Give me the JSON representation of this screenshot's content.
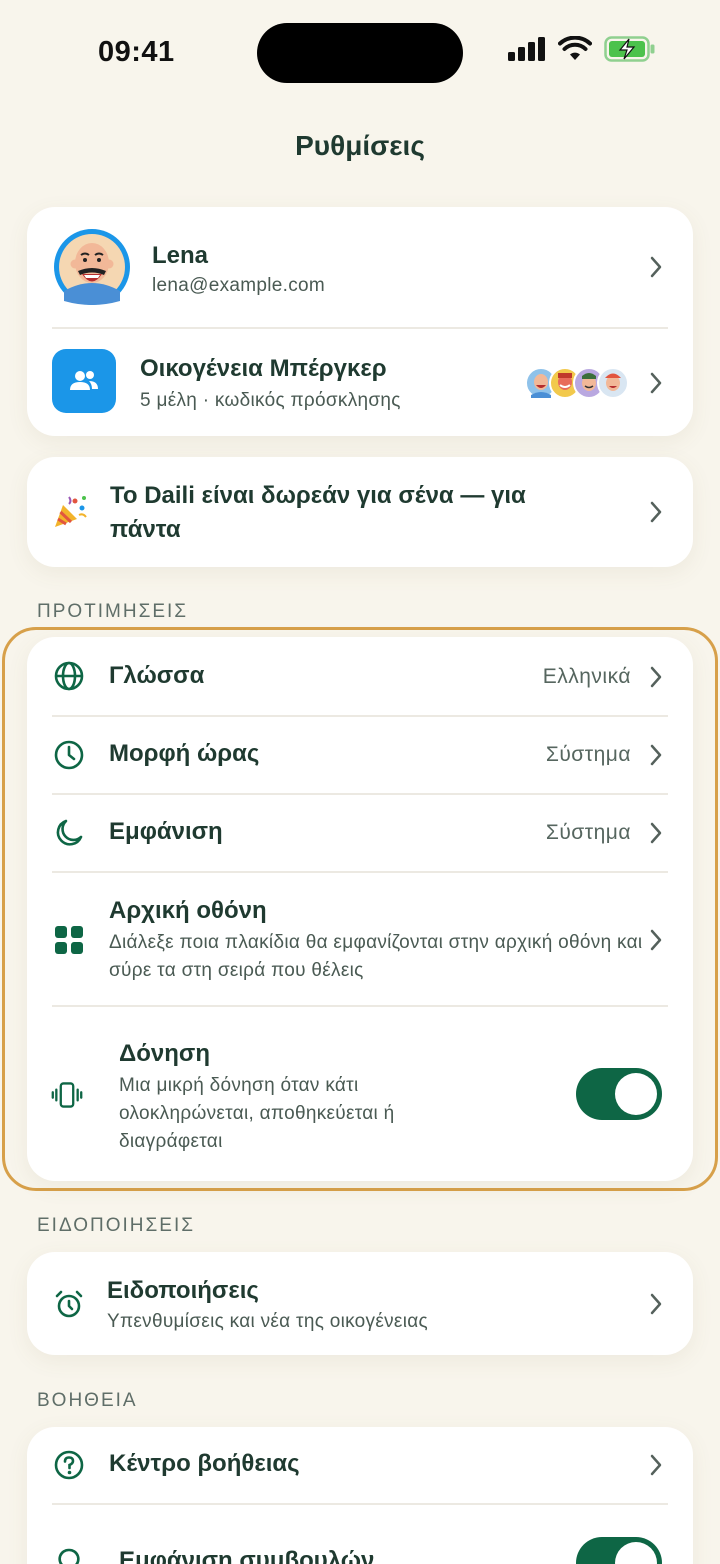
{
  "status_bar": {
    "time": "09:41"
  },
  "header": {
    "title": "Ρυθμίσεις"
  },
  "profile": {
    "name": "Lena",
    "email": "lena@example.com"
  },
  "family": {
    "name": "Οικογένεια Μπέργκερ",
    "subtitle": "5 μέλη · κωδικός πρόσκλησης",
    "member_avatar_count": 4
  },
  "promo": {
    "text": "Το Daili είναι δωρεάν για σένα — για πάντα"
  },
  "preferences": {
    "label": "ΠΡΟΤΙΜΗΣΕΙΣ",
    "language": {
      "title": "Γλώσσα",
      "value": "Ελληνικά"
    },
    "time_format": {
      "title": "Μορφή ώρας",
      "value": "Σύστημα"
    },
    "appearance": {
      "title": "Εμφάνιση",
      "value": "Σύστημα"
    },
    "home_screen": {
      "title": "Αρχική οθόνη",
      "subtitle": "Διάλεξε ποια πλακίδια θα εμφανίζονται στην αρχική οθόνη και σύρε τα στη σειρά που θέλεις"
    },
    "vibration": {
      "title": "Δόνηση",
      "subtitle": "Μια μικρή δόνηση όταν κάτι ολοκληρώνεται, αποθηκεύεται ή διαγράφεται",
      "enabled": true
    }
  },
  "notifications": {
    "label": "ΕΙΔΟΠΟΙΗΣΕΙΣ",
    "item": {
      "title": "Ειδοποιήσεις",
      "subtitle": "Υπενθυμίσεις και νέα της οικογένειας"
    }
  },
  "help": {
    "label": "ΒΟΗΘΕΙΑ",
    "help_center": {
      "title": "Κέντρο βοήθειας"
    },
    "tips": {
      "title": "Εμφάνιση συμβουλών",
      "enabled": true
    }
  },
  "colors": {
    "accent": "#0e6645",
    "icon_blue": "#1b96e8",
    "highlight": "#d7a04a",
    "background": "#f8f5ec"
  }
}
